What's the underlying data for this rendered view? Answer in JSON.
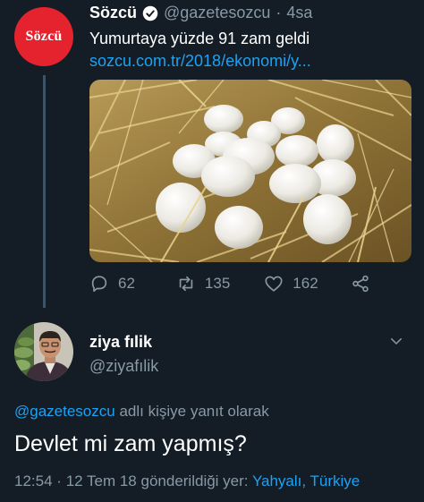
{
  "original_tweet": {
    "avatar_text": "Sözcü",
    "author_name": "Sözcü",
    "handle": "@gazetesozcu",
    "separator": "·",
    "time": "4sa",
    "text": "Yumurtaya yüzde 91 zam geldi",
    "link": "sozcu.com.tr/2018/ekonomi/y...",
    "photo": "eggs-in-straw",
    "actions": {
      "replies": "62",
      "retweets": "135",
      "likes": "162"
    }
  },
  "reply_tweet": {
    "author_name": "ziya fılik",
    "handle": "@ziyafılik",
    "replying_mention": "@gazetesozcu",
    "replying_suffix": "adlı kişiye yanıt olarak",
    "text": "Devlet mi zam yapmış?",
    "time": "12:54",
    "separator": "·",
    "date": "12 Tem 18",
    "location_prefix": "gönderildiği yer:",
    "location": "Yahyalı, Türkiye"
  },
  "colors": {
    "background": "#141d26",
    "accent": "#1da1f2",
    "muted": "#8899a6",
    "brand_red": "#e5232f"
  }
}
